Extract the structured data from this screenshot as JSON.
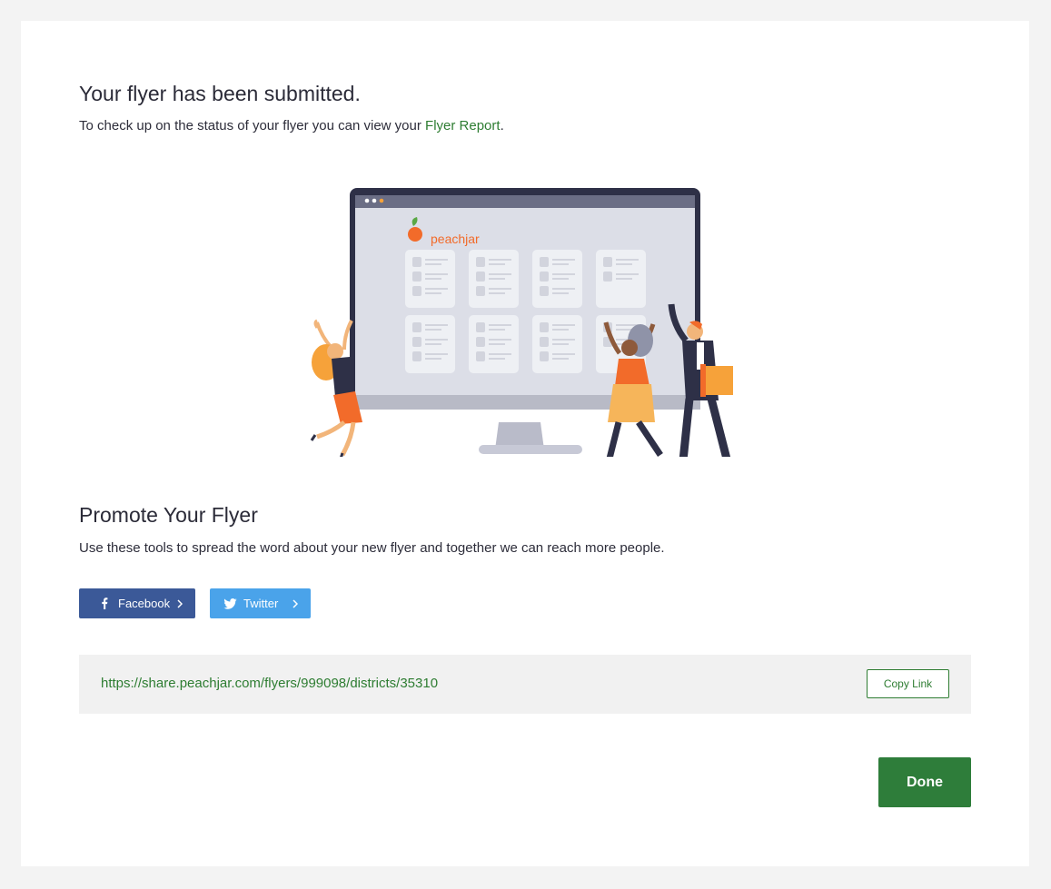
{
  "confirmation": {
    "title": "Your flyer has been submitted.",
    "lead_text": "To check up on the status of your flyer you can view your ",
    "report_link": "Flyer Report",
    "lead_end": "."
  },
  "illustration": {
    "brand_logo_text": "peachjar"
  },
  "promote": {
    "title": "Promote Your Flyer",
    "subtitle": "Use these tools to spread the word about your new flyer and together we can reach more people.",
    "facebook_label": "Facebook",
    "twitter_label": "Twitter",
    "share_url": "https://share.peachjar.com/flyers/999098/districts/35310",
    "copy_label": "Copy Link"
  },
  "actions": {
    "done_label": "Done"
  },
  "colors": {
    "accent_green": "#2e7d32",
    "facebook_blue": "#3b5998",
    "twitter_blue": "#4aa3ea",
    "brand_orange": "#f26b2a"
  }
}
